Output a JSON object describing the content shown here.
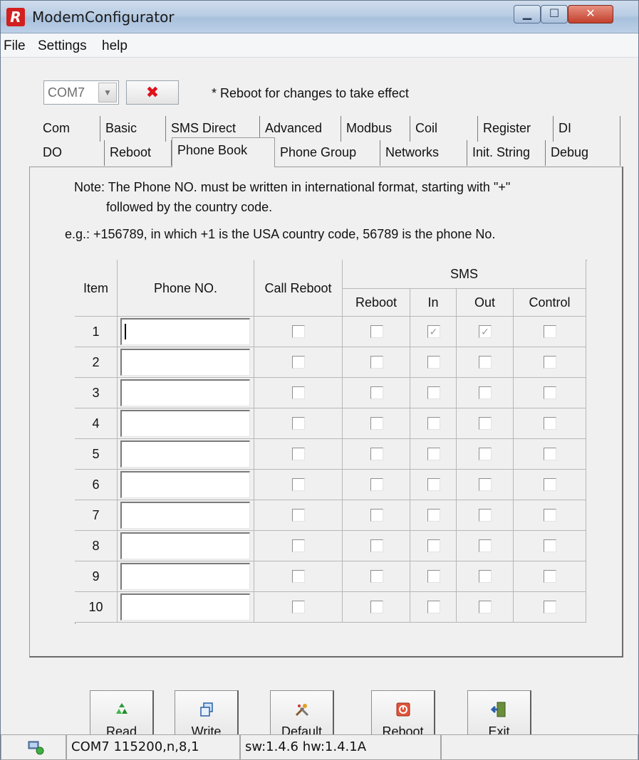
{
  "window": {
    "title": "ModemConfigurator",
    "icon_letter": "R"
  },
  "menu": [
    "File",
    "Settings",
    "help"
  ],
  "toolbar": {
    "com_port": "COM7",
    "close_symbol": "✖",
    "reboot_note": "* Reboot for changes to take effect"
  },
  "tabs_row1": [
    "Com",
    "Basic",
    "SMS Direct",
    "Advanced",
    "Modbus",
    "Coil",
    "Register",
    "DI"
  ],
  "tabs_row2": [
    "DO",
    "Reboot",
    "Phone Book",
    "Phone Group",
    "Networks",
    "Init. String",
    "Debug"
  ],
  "active_tab": "Phone Book",
  "phone_book": {
    "note_line1": "Note: The Phone NO. must be written in international format, starting with \"+\"",
    "note_line2": "followed by the country code.",
    "example": "e.g.: +156789, in which +1 is the USA country code, 56789 is the phone No.",
    "headers": {
      "item": "Item",
      "phone": "Phone NO.",
      "call_reboot": "Call Reboot",
      "sms": "SMS",
      "sms_reboot": "Reboot",
      "sms_in": "In",
      "sms_out": "Out",
      "sms_control": "Control"
    },
    "rows": [
      {
        "item": "1",
        "phone": "",
        "call_reboot": false,
        "sms_reboot": false,
        "sms_in": true,
        "sms_out": true,
        "sms_control": false
      },
      {
        "item": "2",
        "phone": "",
        "call_reboot": false,
        "sms_reboot": false,
        "sms_in": false,
        "sms_out": false,
        "sms_control": false
      },
      {
        "item": "3",
        "phone": "",
        "call_reboot": false,
        "sms_reboot": false,
        "sms_in": false,
        "sms_out": false,
        "sms_control": false
      },
      {
        "item": "4",
        "phone": "",
        "call_reboot": false,
        "sms_reboot": false,
        "sms_in": false,
        "sms_out": false,
        "sms_control": false
      },
      {
        "item": "5",
        "phone": "",
        "call_reboot": false,
        "sms_reboot": false,
        "sms_in": false,
        "sms_out": false,
        "sms_control": false
      },
      {
        "item": "6",
        "phone": "",
        "call_reboot": false,
        "sms_reboot": false,
        "sms_in": false,
        "sms_out": false,
        "sms_control": false
      },
      {
        "item": "7",
        "phone": "",
        "call_reboot": false,
        "sms_reboot": false,
        "sms_in": false,
        "sms_out": false,
        "sms_control": false
      },
      {
        "item": "8",
        "phone": "",
        "call_reboot": false,
        "sms_reboot": false,
        "sms_in": false,
        "sms_out": false,
        "sms_control": false
      },
      {
        "item": "9",
        "phone": "",
        "call_reboot": false,
        "sms_reboot": false,
        "sms_in": false,
        "sms_out": false,
        "sms_control": false
      },
      {
        "item": "10",
        "phone": "",
        "call_reboot": false,
        "sms_reboot": false,
        "sms_in": false,
        "sms_out": false,
        "sms_control": false
      }
    ]
  },
  "buttons": [
    {
      "label": "Read",
      "icon": "recycle-icon"
    },
    {
      "label": "Write",
      "icon": "copy-icon"
    },
    {
      "label": "Default",
      "icon": "tools-icon"
    },
    {
      "label": "Reboot",
      "icon": "power-icon"
    },
    {
      "label": "Exit",
      "icon": "exit-door-icon"
    }
  ],
  "status": {
    "connection": "COM7 115200,n,8,1",
    "version": "sw:1.4.6 hw:1.4.1A",
    "extra": ""
  }
}
